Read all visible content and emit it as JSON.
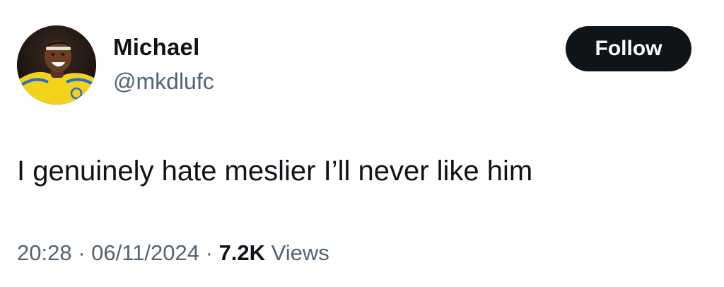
{
  "author": {
    "name": "Michael",
    "handle": "@mkdlufc",
    "avatar": "profile-photo"
  },
  "follow_label": "Follow",
  "tweet": {
    "text": "I genuinely hate meslier I’ll never like him"
  },
  "meta": {
    "time": "20:28",
    "separator1": " · ",
    "date": "06/11/2024",
    "separator2": " · ",
    "views_count": "7.2K",
    "views_label": " Views"
  },
  "colors": {
    "text_primary": "#0f1419",
    "text_secondary": "#536471",
    "button_bg": "#0f1419",
    "button_text": "#ffffff",
    "avatar_shirt": "#f2d21b"
  }
}
